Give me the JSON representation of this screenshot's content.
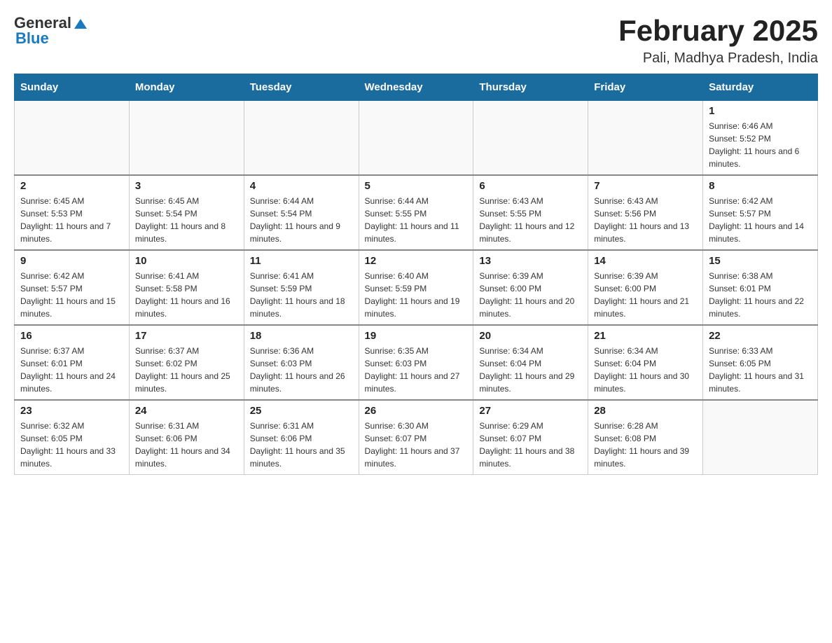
{
  "header": {
    "logo_general": "General",
    "logo_blue": "Blue",
    "month_title": "February 2025",
    "location": "Pali, Madhya Pradesh, India"
  },
  "weekdays": [
    "Sunday",
    "Monday",
    "Tuesday",
    "Wednesday",
    "Thursday",
    "Friday",
    "Saturday"
  ],
  "weeks": [
    [
      {
        "day": "",
        "info": ""
      },
      {
        "day": "",
        "info": ""
      },
      {
        "day": "",
        "info": ""
      },
      {
        "day": "",
        "info": ""
      },
      {
        "day": "",
        "info": ""
      },
      {
        "day": "",
        "info": ""
      },
      {
        "day": "1",
        "info": "Sunrise: 6:46 AM\nSunset: 5:52 PM\nDaylight: 11 hours and 6 minutes."
      }
    ],
    [
      {
        "day": "2",
        "info": "Sunrise: 6:45 AM\nSunset: 5:53 PM\nDaylight: 11 hours and 7 minutes."
      },
      {
        "day": "3",
        "info": "Sunrise: 6:45 AM\nSunset: 5:54 PM\nDaylight: 11 hours and 8 minutes."
      },
      {
        "day": "4",
        "info": "Sunrise: 6:44 AM\nSunset: 5:54 PM\nDaylight: 11 hours and 9 minutes."
      },
      {
        "day": "5",
        "info": "Sunrise: 6:44 AM\nSunset: 5:55 PM\nDaylight: 11 hours and 11 minutes."
      },
      {
        "day": "6",
        "info": "Sunrise: 6:43 AM\nSunset: 5:55 PM\nDaylight: 11 hours and 12 minutes."
      },
      {
        "day": "7",
        "info": "Sunrise: 6:43 AM\nSunset: 5:56 PM\nDaylight: 11 hours and 13 minutes."
      },
      {
        "day": "8",
        "info": "Sunrise: 6:42 AM\nSunset: 5:57 PM\nDaylight: 11 hours and 14 minutes."
      }
    ],
    [
      {
        "day": "9",
        "info": "Sunrise: 6:42 AM\nSunset: 5:57 PM\nDaylight: 11 hours and 15 minutes."
      },
      {
        "day": "10",
        "info": "Sunrise: 6:41 AM\nSunset: 5:58 PM\nDaylight: 11 hours and 16 minutes."
      },
      {
        "day": "11",
        "info": "Sunrise: 6:41 AM\nSunset: 5:59 PM\nDaylight: 11 hours and 18 minutes."
      },
      {
        "day": "12",
        "info": "Sunrise: 6:40 AM\nSunset: 5:59 PM\nDaylight: 11 hours and 19 minutes."
      },
      {
        "day": "13",
        "info": "Sunrise: 6:39 AM\nSunset: 6:00 PM\nDaylight: 11 hours and 20 minutes."
      },
      {
        "day": "14",
        "info": "Sunrise: 6:39 AM\nSunset: 6:00 PM\nDaylight: 11 hours and 21 minutes."
      },
      {
        "day": "15",
        "info": "Sunrise: 6:38 AM\nSunset: 6:01 PM\nDaylight: 11 hours and 22 minutes."
      }
    ],
    [
      {
        "day": "16",
        "info": "Sunrise: 6:37 AM\nSunset: 6:01 PM\nDaylight: 11 hours and 24 minutes."
      },
      {
        "day": "17",
        "info": "Sunrise: 6:37 AM\nSunset: 6:02 PM\nDaylight: 11 hours and 25 minutes."
      },
      {
        "day": "18",
        "info": "Sunrise: 6:36 AM\nSunset: 6:03 PM\nDaylight: 11 hours and 26 minutes."
      },
      {
        "day": "19",
        "info": "Sunrise: 6:35 AM\nSunset: 6:03 PM\nDaylight: 11 hours and 27 minutes."
      },
      {
        "day": "20",
        "info": "Sunrise: 6:34 AM\nSunset: 6:04 PM\nDaylight: 11 hours and 29 minutes."
      },
      {
        "day": "21",
        "info": "Sunrise: 6:34 AM\nSunset: 6:04 PM\nDaylight: 11 hours and 30 minutes."
      },
      {
        "day": "22",
        "info": "Sunrise: 6:33 AM\nSunset: 6:05 PM\nDaylight: 11 hours and 31 minutes."
      }
    ],
    [
      {
        "day": "23",
        "info": "Sunrise: 6:32 AM\nSunset: 6:05 PM\nDaylight: 11 hours and 33 minutes."
      },
      {
        "day": "24",
        "info": "Sunrise: 6:31 AM\nSunset: 6:06 PM\nDaylight: 11 hours and 34 minutes."
      },
      {
        "day": "25",
        "info": "Sunrise: 6:31 AM\nSunset: 6:06 PM\nDaylight: 11 hours and 35 minutes."
      },
      {
        "day": "26",
        "info": "Sunrise: 6:30 AM\nSunset: 6:07 PM\nDaylight: 11 hours and 37 minutes."
      },
      {
        "day": "27",
        "info": "Sunrise: 6:29 AM\nSunset: 6:07 PM\nDaylight: 11 hours and 38 minutes."
      },
      {
        "day": "28",
        "info": "Sunrise: 6:28 AM\nSunset: 6:08 PM\nDaylight: 11 hours and 39 minutes."
      },
      {
        "day": "",
        "info": ""
      }
    ]
  ]
}
